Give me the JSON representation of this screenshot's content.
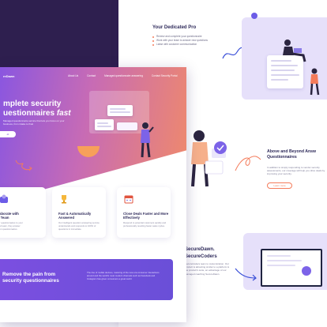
{
  "back_page": {
    "section1_title": "Your Dedicated Pro",
    "section1_items": [
      "Review and complete your questionnaire",
      "Work with your team to answer new questions",
      "Liaise with customer communication"
    ],
    "section2_title_line1": "Above and Beyond Answ",
    "section2_title_line2": "Questionnaires",
    "section2_text": "In addition to simply responding to vendor security assessments, our coverage will help you drive deals by improving your security.",
    "section2_button": "Learn more",
    "section3_title_line1": "SecureDawn.",
    "section3_title_line2": "SecureCoders",
    "section3_text": "SecureCoders team to customization. Our product is attracting similar to a platform & the product's suite, an advantage of our managed coaching SecureDawn."
  },
  "front_page": {
    "logo": "reDawn",
    "nav": [
      "About Us",
      "Contact",
      "Managed questionnaire answering",
      "Contact Security Portal"
    ],
    "hero_line1": "mplete security",
    "hero_line2": "uestionnaires",
    "hero_line2_fast": "fast",
    "hero_sub": "Managed questionnaire service that lets you focus on your business, from intake to final",
    "hero_cta": "ct",
    "features": [
      {
        "icon": "people-icon",
        "title": "laborate with\nr Team",
        "text": "ur questionnaires to your\nted team, they answer\ntion questionnaires."
      },
      {
        "icon": "trophy-icon",
        "title": "Fast & Automatically Answered",
        "text": "Our intelligent question answering service understands and responds to 100% of questions in immediate."
      },
      {
        "icon": "calendar-icon",
        "title": "Close Deals Faster and More Effectively",
        "text": "Respond to potential customers quickly and professionally resulting faster sales cycles."
      }
    ],
    "banner_line1": "Remove the pain from",
    "banner_line2": "security questionnaires",
    "banner_text": "The rise of mobile devices, maturing of the new era consumer interactions around and the world's most modern channels such as Facebook and Instagram has given consumers a great world"
  }
}
